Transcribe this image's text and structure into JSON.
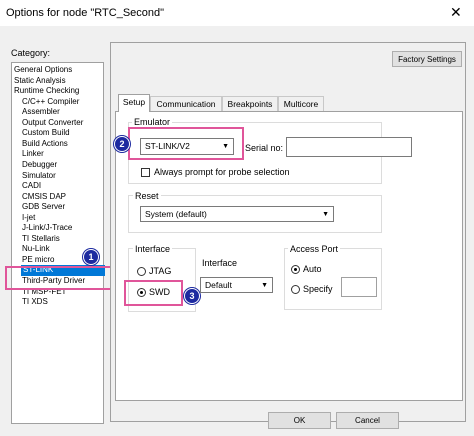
{
  "window": {
    "title": "Options for node \"RTC_Second\"",
    "close_glyph": "✕"
  },
  "category": {
    "label": "Category:",
    "items": [
      {
        "label": "General Options",
        "indent": false
      },
      {
        "label": "Static Analysis",
        "indent": false
      },
      {
        "label": "Runtime Checking",
        "indent": false
      },
      {
        "label": "C/C++ Compiler",
        "indent": true
      },
      {
        "label": "Assembler",
        "indent": true
      },
      {
        "label": "Output Converter",
        "indent": true
      },
      {
        "label": "Custom Build",
        "indent": true
      },
      {
        "label": "Build Actions",
        "indent": true
      },
      {
        "label": "Linker",
        "indent": true
      },
      {
        "label": "Debugger",
        "indent": true
      },
      {
        "label": "Simulator",
        "indent": true
      },
      {
        "label": "CADI",
        "indent": true
      },
      {
        "label": "CMSIS DAP",
        "indent": true
      },
      {
        "label": "GDB Server",
        "indent": true
      },
      {
        "label": "I-jet",
        "indent": true
      },
      {
        "label": "J-Link/J-Trace",
        "indent": true
      },
      {
        "label": "TI Stellaris",
        "indent": true
      },
      {
        "label": "Nu-Link",
        "indent": true
      },
      {
        "label": "PE micro",
        "indent": true
      },
      {
        "label": "ST-LINK",
        "indent": true,
        "selected": true
      },
      {
        "label": "Third-Party Driver",
        "indent": true
      },
      {
        "label": "TI MSP-FET",
        "indent": true
      },
      {
        "label": "TI XDS",
        "indent": true
      }
    ]
  },
  "factory_settings": "Factory Settings",
  "tabs": [
    "Setup",
    "Communication",
    "Breakpoints",
    "Multicore"
  ],
  "emulator": {
    "group": "Emulator",
    "selected": "ST-LINK/V2",
    "serial_label": "Serial no:",
    "serial_value": "",
    "always_prompt": "Always prompt for probe selection",
    "always_prompt_checked": false
  },
  "reset": {
    "group": "Reset",
    "selected": "System (default)"
  },
  "interface": {
    "group": "Interface",
    "jtag": "JTAG",
    "swd": "SWD",
    "selected": "SWD"
  },
  "interface_speed": {
    "label": "Interface",
    "selected": "Default"
  },
  "access_port": {
    "group": "Access Port",
    "auto": "Auto",
    "specify": "Specify",
    "selected": "Auto",
    "value": ""
  },
  "badges": [
    "1",
    "2",
    "3"
  ],
  "footer": {
    "ok": "OK",
    "cancel": "Cancel"
  },
  "colors": {
    "selection": "#0078d7",
    "highlight": "#e0559a",
    "badge": "#1d2aa0"
  }
}
